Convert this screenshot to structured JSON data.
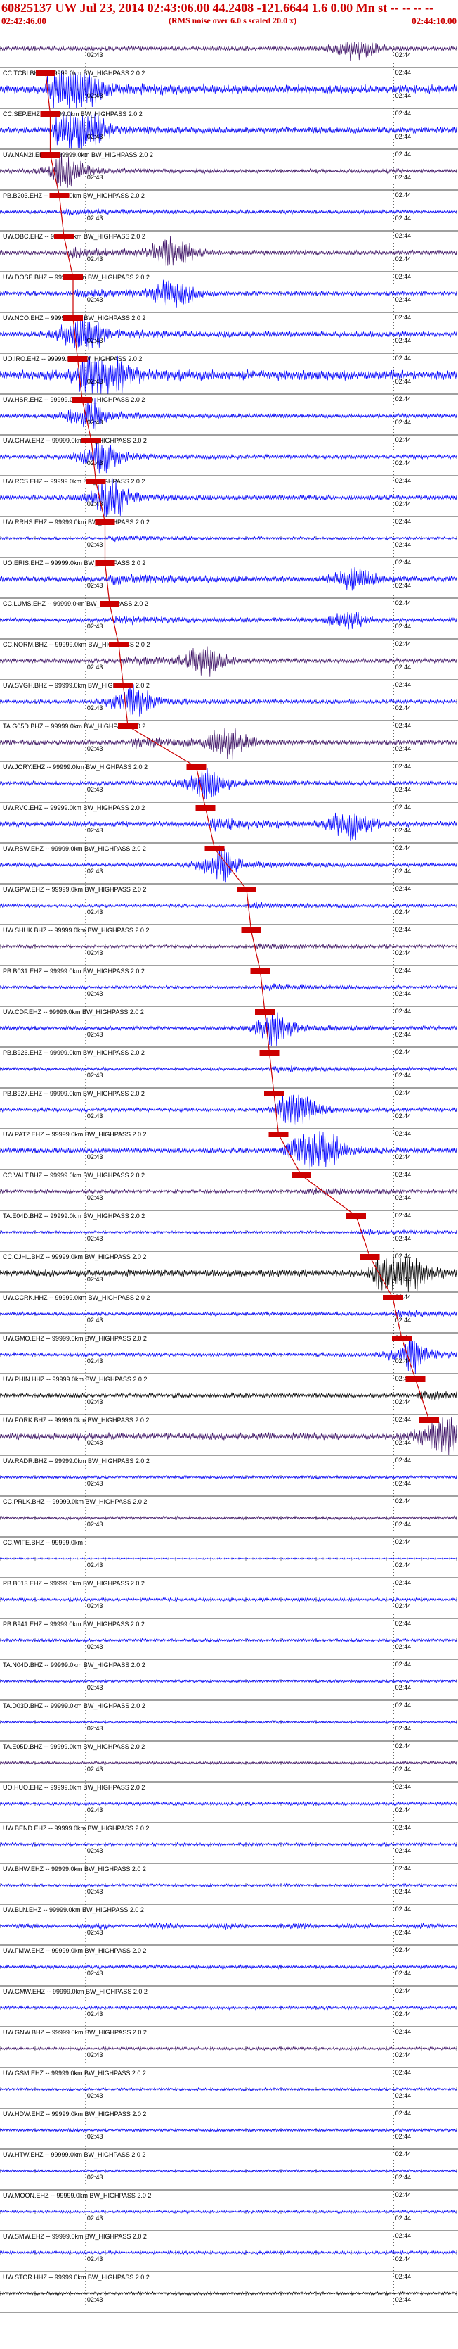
{
  "header": {
    "title": "60825137 UW Jul 23, 2014 02:43:06.00   44.2408 -121.6644  1.6 0.00 Mn st -- -- -- --",
    "start_time": "02:42:46.00",
    "note": "(RMS noise over 6.0 s scaled 20.0 x)",
    "end_time": "02:44:10.00"
  },
  "colors": {
    "header_text": "#cc0000",
    "trace_blue": "#0000ff",
    "trace_purple": "#3d1166",
    "trace_black": "#000000",
    "pick_marker": "#cc0000",
    "timing_lines": "#000000"
  },
  "chart_data": {
    "type": "line",
    "title": "60825137 UW Jul 23, 2014 02:43:06.00 44.2408 -121.6644 1.6 0.00 Mn",
    "xlabel": "",
    "ylabel": "",
    "x_range": [
      "02:42:46.00",
      "02:44:10.00"
    ],
    "tick_labels": [
      "02:43",
      "02:44"
    ],
    "grid": "vertical timing lines",
    "series": [
      {
        "name": "CC.TCBI.EHZ -- 99999.0km BW_HIGHPASS 2.0 2",
        "pick_frac": null,
        "amp": 1.6,
        "burst": 0.78,
        "color": "purple"
      },
      {
        "name": "CC.TCBI.BHZ -- 99999.0km BW_HIGHPASS 2.0 2",
        "pick_frac": 0.1,
        "amp": 3.2,
        "burst": 0.16,
        "color": "blue"
      },
      {
        "name": "CC.SEP.EHZ -- 99999.0km BW_HIGHPASS 2.0 2",
        "pick_frac": 0.11,
        "amp": 2.2,
        "burst": 0.18,
        "color": "blue"
      },
      {
        "name": "UW.NAN2I.EHZ 01 99999.0km BW_HIGHPASS 2.0 2",
        "pick_frac": 0.11,
        "amp": 1.3,
        "burst": 0.14,
        "color": "purple"
      },
      {
        "name": "PB.B203.EHZ -- 99999.0km BW_HIGHPASS 2.0 2",
        "pick_frac": 0.13,
        "amp": 1.2,
        "burst": null,
        "color": "blue"
      },
      {
        "name": "UW.OBC.EHZ -- 99999.0km BW_HIGHPASS 2.0 2",
        "pick_frac": 0.14,
        "amp": 1.8,
        "burst": 0.38,
        "color": "purple"
      },
      {
        "name": "UW.DOSE.BHZ -- 99999.0km BW_HIGHPASS 2.0 2",
        "pick_frac": 0.16,
        "amp": 1.6,
        "burst": 0.38,
        "color": "blue"
      },
      {
        "name": "UW.NCO.EHZ -- 99999.0km BW_HIGHPASS 2.0 2",
        "pick_frac": 0.16,
        "amp": 2.0,
        "burst": 0.17,
        "color": "blue"
      },
      {
        "name": "UO.IRO.EHZ -- 99999.0km BW_HIGHPASS 2.0 2",
        "pick_frac": 0.17,
        "amp": 3.4,
        "burst": 0.22,
        "color": "blue"
      },
      {
        "name": "UW.HSR.EHZ -- 99999.0km BW_HIGHPASS 2.0 2",
        "pick_frac": 0.18,
        "amp": 1.4,
        "burst": 0.18,
        "color": "blue"
      },
      {
        "name": "UW.GHW.EHZ -- 99999.0km BW_HIGHPASS 2.0 2",
        "pick_frac": 0.2,
        "amp": 1.4,
        "burst": 0.21,
        "color": "blue"
      },
      {
        "name": "UW.RCS.EHZ -- 99999.0km BW_HIGHPASS 2.0 2",
        "pick_frac": 0.21,
        "amp": 1.7,
        "burst": 0.23,
        "color": "blue"
      },
      {
        "name": "UW.RRHS.EHZ -- 99999.0km BW_HIGHPASS 2.0 2",
        "pick_frac": 0.23,
        "amp": 1.0,
        "burst": null,
        "color": "blue"
      },
      {
        "name": "UO.ERIS.EHZ -- 99999.0km BW_HIGHPASS 2.0 2",
        "pick_frac": 0.23,
        "amp": 1.9,
        "burst": 0.78,
        "color": "blue"
      },
      {
        "name": "CC.LUMS.EHZ -- 99999.0km BW_HIGHPASS 2.0 2",
        "pick_frac": 0.24,
        "amp": 1.5,
        "burst": 0.76,
        "color": "blue"
      },
      {
        "name": "CC.NORM.BHZ -- 99999.0km BW_HIGHPASS 2.0 2",
        "pick_frac": 0.26,
        "amp": 1.6,
        "burst": 0.45,
        "color": "purple"
      },
      {
        "name": "UW.SVGH.BHZ -- 99999.0km BW_HIGHPASS 2.0 2",
        "pick_frac": 0.27,
        "amp": 1.4,
        "burst": 0.28,
        "color": "blue"
      },
      {
        "name": "TA.G05D.BHZ -- 99999.0km BW_HIGHPASS 2.0 2",
        "pick_frac": 0.28,
        "amp": 1.8,
        "burst": 0.5,
        "color": "purple"
      },
      {
        "name": "UW.JORY.EHZ -- 99999.0km BW_HIGHPASS 2.0 2",
        "pick_frac": 0.43,
        "amp": 1.5,
        "burst": 0.44,
        "color": "blue"
      },
      {
        "name": "UW.RVC.EHZ -- 99999.0km BW_HIGHPASS 2.0 2",
        "pick_frac": 0.45,
        "amp": 2.0,
        "burst": 0.77,
        "color": "blue"
      },
      {
        "name": "UW.RSW.EHZ -- 99999.0km BW_HIGHPASS 2.0 2",
        "pick_frac": 0.47,
        "amp": 1.3,
        "burst": 0.47,
        "color": "blue"
      },
      {
        "name": "UW.GPW.EHZ -- 99999.0km BW_HIGHPASS 2.0 2",
        "pick_frac": 0.54,
        "amp": 1.2,
        "burst": null,
        "color": "blue"
      },
      {
        "name": "UW.SHUK.BHZ -- 99999.0km BW_HIGHPASS 2.0 2",
        "pick_frac": 0.55,
        "amp": 1.1,
        "burst": null,
        "color": "purple"
      },
      {
        "name": "PB.B031.EHZ -- 99999.0km BW_HIGHPASS 2.0 2",
        "pick_frac": 0.57,
        "amp": 1.1,
        "burst": null,
        "color": "blue"
      },
      {
        "name": "UW.CDF.EHZ -- 99999.0km BW_HIGHPASS 2.0 2",
        "pick_frac": 0.58,
        "amp": 1.3,
        "burst": 0.59,
        "color": "blue"
      },
      {
        "name": "PB.B926.EHZ -- 99999.0km BW_HIGHPASS 2.0 2",
        "pick_frac": 0.59,
        "amp": 1.1,
        "burst": null,
        "color": "blue"
      },
      {
        "name": "PB.B927.EHZ -- 99999.0km BW_HIGHPASS 2.0 2",
        "pick_frac": 0.6,
        "amp": 1.3,
        "burst": 0.65,
        "color": "blue"
      },
      {
        "name": "UW.PAT2.EHZ -- 99999.0km BW_HIGHPASS 2.0 2",
        "pick_frac": 0.61,
        "amp": 1.9,
        "burst": 0.7,
        "color": "blue"
      },
      {
        "name": "CC.VALT.BHZ -- 99999.0km BW_HIGHPASS 2.0 2",
        "pick_frac": 0.66,
        "amp": 1.2,
        "burst": null,
        "color": "purple"
      },
      {
        "name": "TA.E04D.BHZ -- 99999.0km BW_HIGHPASS 2.0 2",
        "pick_frac": 0.78,
        "amp": 1.0,
        "burst": null,
        "color": "blue"
      },
      {
        "name": "CC.CJHL.BHZ -- 99999.0km BW_HIGHPASS 2.0 2",
        "pick_frac": 0.81,
        "amp": 2.6,
        "burst": 0.88,
        "color": "black"
      },
      {
        "name": "UW.CCRK.HHZ -- 99999.0km BW_HIGHPASS 2.0 2",
        "pick_frac": 0.86,
        "amp": 1.2,
        "burst": null,
        "color": "blue"
      },
      {
        "name": "UW.GMO.EHZ -- 99999.0km BW_HIGHPASS 2.0 2",
        "pick_frac": 0.88,
        "amp": 1.3,
        "burst": 0.89,
        "color": "blue"
      },
      {
        "name": "UW.PHIN.HHZ -- 99999.0km BW_HIGHPASS 2.0 2",
        "pick_frac": 0.91,
        "amp": 1.6,
        "burst": null,
        "color": "black"
      },
      {
        "name": "UW.FORK.BHZ -- 99999.0km BW_HIGHPASS 2.0 2",
        "pick_frac": 0.94,
        "amp": 2.4,
        "burst": 0.96,
        "color": "purple"
      },
      {
        "name": "UW.RADR.BHZ -- 99999.0km BW_HIGHPASS 2.0 2",
        "pick_frac": null,
        "amp": 1.1,
        "burst": null,
        "color": "blue"
      },
      {
        "name": "CC.PRLK.BHZ -- 99999.0km BW_HIGHPASS 2.0 2",
        "pick_frac": null,
        "amp": 1.1,
        "burst": null,
        "color": "purple"
      },
      {
        "name": "CC.WIFE.BHZ -- 99999.0km",
        "pick_frac": null,
        "amp": 0.5,
        "burst": null,
        "color": "blue"
      },
      {
        "name": "PB.B013.EHZ -- 99999.0km BW_HIGHPASS 2.0 2",
        "pick_frac": null,
        "amp": 1.1,
        "burst": null,
        "color": "blue"
      },
      {
        "name": "PB.B941.EHZ -- 99999.0km BW_HIGHPASS 2.0 2",
        "pick_frac": null,
        "amp": 1.1,
        "burst": null,
        "color": "blue"
      },
      {
        "name": "TA.N04D.BHZ -- 99999.0km BW_HIGHPASS 2.0 2",
        "pick_frac": null,
        "amp": 0.9,
        "burst": null,
        "color": "blue"
      },
      {
        "name": "TA.D03D.BHZ -- 99999.0km BW_HIGHPASS 2.0 2",
        "pick_frac": null,
        "amp": 0.9,
        "burst": null,
        "color": "blue"
      },
      {
        "name": "TA.E05D.BHZ -- 99999.0km BW_HIGHPASS 2.0 2",
        "pick_frac": null,
        "amp": 0.9,
        "burst": null,
        "color": "purple"
      },
      {
        "name": "UO.HUO.EHZ -- 99999.0km BW_HIGHPASS 2.0 2",
        "pick_frac": null,
        "amp": 1.2,
        "burst": null,
        "color": "blue"
      },
      {
        "name": "UW.BEND.EHZ -- 99999.0km BW_HIGHPASS 2.0 2",
        "pick_frac": null,
        "amp": 1.1,
        "burst": null,
        "color": "blue"
      },
      {
        "name": "UW.BHW.EHZ -- 99999.0km BW_HIGHPASS 2.0 2",
        "pick_frac": null,
        "amp": 1.0,
        "burst": null,
        "color": "blue"
      },
      {
        "name": "UW.BLN.EHZ -- 99999.0km BW_HIGHPASS 2.0 2",
        "pick_frac": null,
        "amp": 1.0,
        "burst": null,
        "color": "blue",
        "wavy": true
      },
      {
        "name": "UW.FMW.EHZ -- 99999.0km BW_HIGHPASS 2.0 2",
        "pick_frac": null,
        "amp": 1.2,
        "burst": null,
        "color": "blue"
      },
      {
        "name": "UW.GMW.EHZ -- 99999.0km BW_HIGHPASS 2.0 2",
        "pick_frac": null,
        "amp": 1.2,
        "burst": null,
        "color": "blue"
      },
      {
        "name": "UW.GNW.BHZ -- 99999.0km BW_HIGHPASS 2.0 2",
        "pick_frac": null,
        "amp": 1.0,
        "burst": null,
        "color": "purple"
      },
      {
        "name": "UW.GSM.EHZ -- 99999.0km BW_HIGHPASS 2.0 2",
        "pick_frac": null,
        "amp": 1.0,
        "burst": null,
        "color": "blue"
      },
      {
        "name": "UW.HDW.EHZ -- 99999.0km BW_HIGHPASS 2.0 2",
        "pick_frac": null,
        "amp": 1.0,
        "burst": null,
        "color": "blue"
      },
      {
        "name": "UW.HTW.EHZ -- 99999.0km BW_HIGHPASS 2.0 2",
        "pick_frac": null,
        "amp": 0.9,
        "burst": null,
        "color": "blue"
      },
      {
        "name": "UW.MOON.EHZ -- 99999.0km BW_HIGHPASS 2.0 2",
        "pick_frac": null,
        "amp": 1.0,
        "burst": null,
        "color": "blue"
      },
      {
        "name": "UW.SMW.EHZ -- 99999.0km BW_HIGHPASS 2.0 2",
        "pick_frac": null,
        "amp": 1.1,
        "burst": null,
        "color": "blue"
      },
      {
        "name": "UW.STOR.HHZ -- 99999.0km BW_HIGHPASS 2.0 2",
        "pick_frac": null,
        "amp": 1.0,
        "burst": null,
        "color": "black"
      }
    ]
  }
}
